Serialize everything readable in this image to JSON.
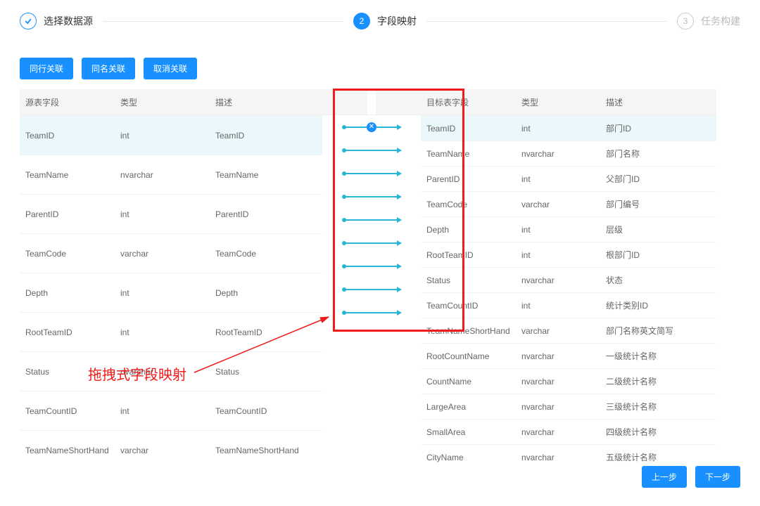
{
  "steps": {
    "s1": "选择数据源",
    "s2_num": "2",
    "s2": "字段映射",
    "s3_num": "3",
    "s3": "任务构建"
  },
  "buttons": {
    "same_row": "同行关联",
    "same_name": "同名关联",
    "cancel": "取消关联",
    "prev": "上一步",
    "next": "下一步"
  },
  "headers": {
    "src_field": "源表字段",
    "type": "类型",
    "desc": "描述",
    "tgt_field": "目标表字段"
  },
  "source_rows": [
    {
      "field": "TeamID",
      "type": "int",
      "desc": "TeamID"
    },
    {
      "field": "TeamName",
      "type": "nvarchar",
      "desc": "TeamName"
    },
    {
      "field": "ParentID",
      "type": "int",
      "desc": "ParentID"
    },
    {
      "field": "TeamCode",
      "type": "varchar",
      "desc": "TeamCode"
    },
    {
      "field": "Depth",
      "type": "int",
      "desc": "Depth"
    },
    {
      "field": "RootTeamID",
      "type": "int",
      "desc": "RootTeamID"
    },
    {
      "field": "Status",
      "type": "nvarchar",
      "desc": "Status"
    },
    {
      "field": "TeamCountID",
      "type": "int",
      "desc": "TeamCountID"
    },
    {
      "field": "TeamNameShortHand",
      "type": "varchar",
      "desc": "TeamNameShortHand"
    }
  ],
  "target_rows": [
    {
      "field": "TeamID",
      "type": "int",
      "desc": "部门ID"
    },
    {
      "field": "TeamName",
      "type": "nvarchar",
      "desc": "部门名称"
    },
    {
      "field": "ParentID",
      "type": "int",
      "desc": "父部门ID"
    },
    {
      "field": "TeamCode",
      "type": "varchar",
      "desc": "部门编号"
    },
    {
      "field": "Depth",
      "type": "int",
      "desc": "层级"
    },
    {
      "field": "RootTeamID",
      "type": "int",
      "desc": "根部门ID"
    },
    {
      "field": "Status",
      "type": "nvarchar",
      "desc": "状态"
    },
    {
      "field": "TeamCountID",
      "type": "int",
      "desc": "统计类别ID"
    },
    {
      "field": "TeamNameShortHand",
      "type": "varchar",
      "desc": "部门名称英文简写"
    },
    {
      "field": "RootCountName",
      "type": "nvarchar",
      "desc": "一级统计名称"
    },
    {
      "field": "CountName",
      "type": "nvarchar",
      "desc": "二级统计名称"
    },
    {
      "field": "LargeArea",
      "type": "nvarchar",
      "desc": "三级统计名称"
    },
    {
      "field": "SmallArea",
      "type": "nvarchar",
      "desc": "四级统计名称"
    },
    {
      "field": "CityName",
      "type": "nvarchar",
      "desc": "五级统计名称"
    }
  ],
  "link_count": 9,
  "annotation": {
    "label": "拖拽式字段映射",
    "remove_glyph": "✕"
  }
}
